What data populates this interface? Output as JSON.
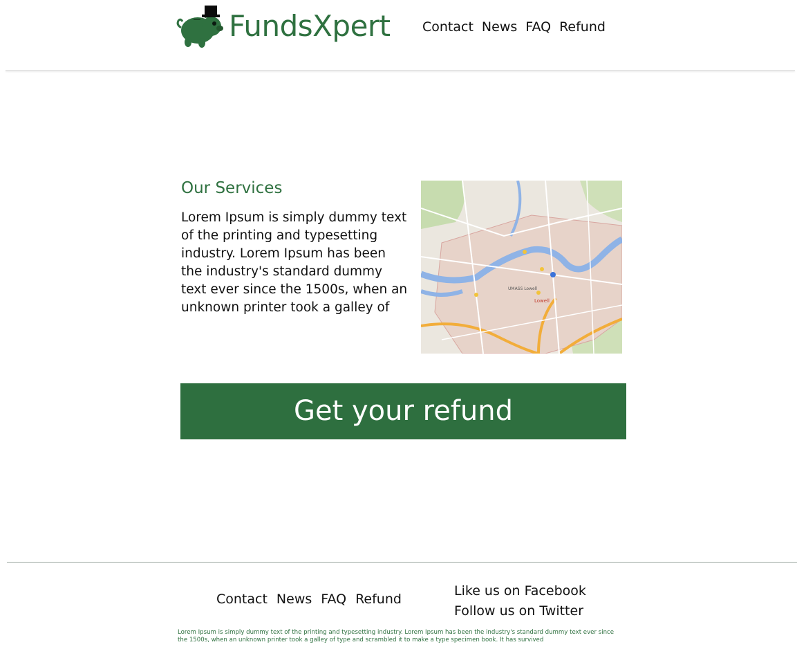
{
  "brand": {
    "name": "FundsXpert",
    "color": "#2f7140",
    "logo_icon": "pig-with-top-hat-icon"
  },
  "header": {
    "nav": [
      {
        "label": "Contact"
      },
      {
        "label": "News"
      },
      {
        "label": "FAQ"
      },
      {
        "label": "Refund"
      }
    ]
  },
  "services": {
    "heading": "Our Services",
    "body": "Lorem Ipsum is simply dummy text of the printing and typesetting industry. Lorem Ipsum has been the industry's standard dummy text ever since the 1500s, when an unknown printer took a galley of",
    "map": {
      "icon": "map-icon",
      "city_label": "Lowell",
      "place_label": "UMASS Lowell"
    }
  },
  "cta": {
    "label": "Get your refund",
    "color": "#2e6f3f"
  },
  "footer": {
    "nav": [
      {
        "label": "Contact"
      },
      {
        "label": "News"
      },
      {
        "label": "FAQ"
      },
      {
        "label": "Refund"
      }
    ],
    "social": {
      "facebook": "Like us on Facebook",
      "twitter": "Follow us on Twitter"
    },
    "text": "Lorem Ipsum is simply dummy text of the printing and typesetting industry. Lorem Ipsum has been the industry's standard dummy text ever since the 1500s, when an unknown printer took a galley of type and scrambled it to make a type specimen book. It has survived"
  }
}
